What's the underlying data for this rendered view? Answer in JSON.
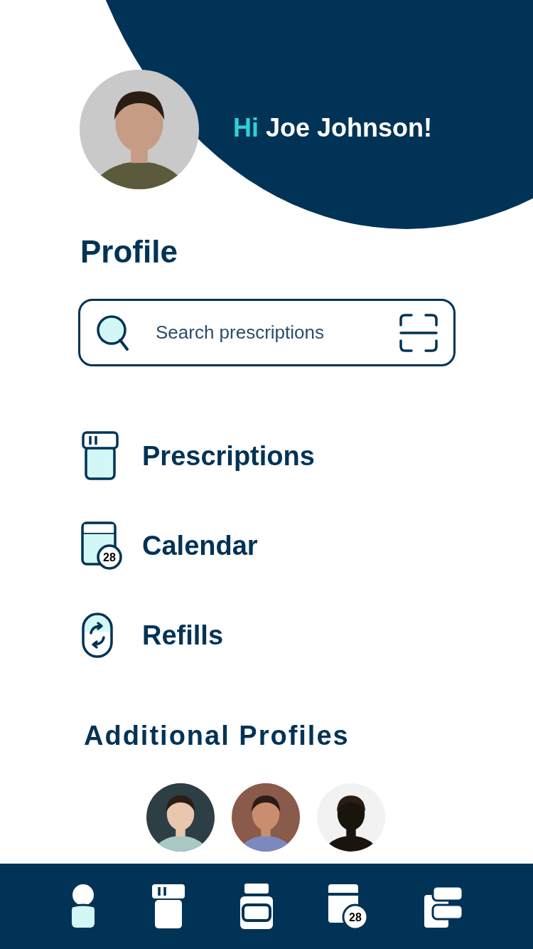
{
  "greeting": {
    "hi": "Hi",
    "name": "Joe Johnson!"
  },
  "title": "Profile",
  "search": {
    "placeholder": "Search prescriptions"
  },
  "menu": [
    {
      "kind": "prescriptions",
      "label": "Prescriptions"
    },
    {
      "kind": "calendar",
      "label": "Calendar",
      "badge": "28"
    },
    {
      "kind": "refills",
      "label": "Refills"
    }
  ],
  "additional_profiles": {
    "title": "Additional Profiles"
  },
  "nav": [
    {
      "kind": "profile",
      "selected": true
    },
    {
      "kind": "prescriptions",
      "selected": false
    },
    {
      "kind": "bottle",
      "selected": false
    },
    {
      "kind": "calendar",
      "selected": false,
      "badge": "28"
    },
    {
      "kind": "refills",
      "selected": false
    }
  ]
}
